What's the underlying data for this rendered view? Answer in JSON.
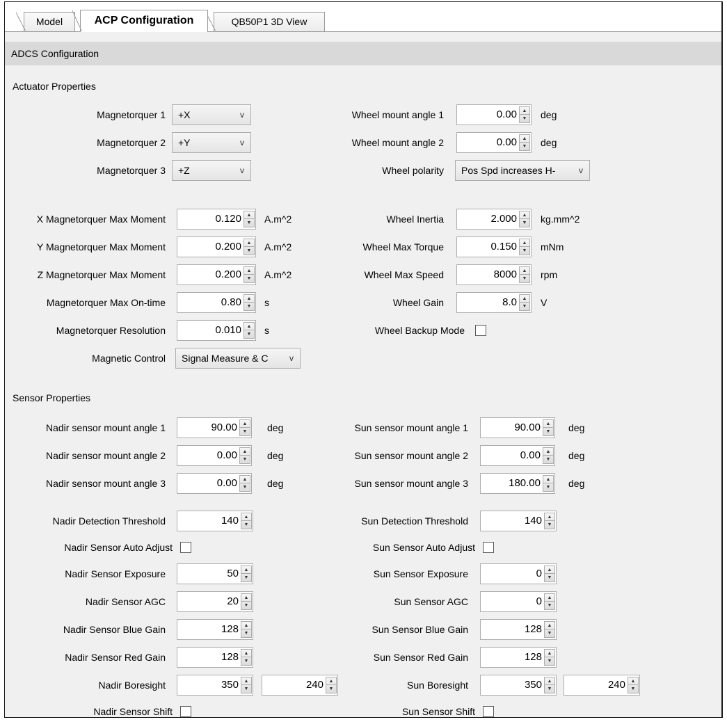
{
  "tabs": [
    "Model",
    "ACP Configuration",
    "QB50P1 3D View"
  ],
  "header": "ADCS Configuration",
  "sections": {
    "actuator": "Actuator Properties",
    "sensor": "Sensor Properties"
  },
  "units": {
    "deg": "deg",
    "am2": "A.m^2",
    "s": "s",
    "kgmm2": "kg.mm^2",
    "mNm": "mNm",
    "rpm": "rpm",
    "V": "V"
  },
  "actuator": {
    "mt1": {
      "label": "Magnetorquer 1",
      "value": "+X"
    },
    "mt2": {
      "label": "Magnetorquer 2",
      "value": "+Y"
    },
    "mt3": {
      "label": "Magnetorquer 3",
      "value": "+Z"
    },
    "wma1": {
      "label": "Wheel mount angle 1",
      "value": "0.00"
    },
    "wma2": {
      "label": "Wheel mount angle 2",
      "value": "0.00"
    },
    "wpol": {
      "label": "Wheel polarity",
      "value": "Pos Spd increases H-"
    },
    "xmax": {
      "label": "X Magnetorquer Max Moment",
      "value": "0.120"
    },
    "ymax": {
      "label": "Y Magnetorquer Max Moment",
      "value": "0.200"
    },
    "zmax": {
      "label": "Z Magnetorquer Max Moment",
      "value": "0.200"
    },
    "ontime": {
      "label": "Magnetorquer Max On-time",
      "value": "0.80"
    },
    "res": {
      "label": "Magnetorquer Resolution",
      "value": "0.010"
    },
    "magctl": {
      "label": "Magnetic Control",
      "value": "Signal Measure & C"
    },
    "winertia": {
      "label": "Wheel Inertia",
      "value": "2.000"
    },
    "wtorque": {
      "label": "Wheel Max Torque",
      "value": "0.150"
    },
    "wspeed": {
      "label": "Wheel Max Speed",
      "value": "8000"
    },
    "wgain": {
      "label": "Wheel Gain",
      "value": "8.0"
    },
    "wbackup": {
      "label": "Wheel Backup Mode",
      "checked": false
    }
  },
  "sensor": {
    "nma1": {
      "label": "Nadir sensor mount angle 1",
      "value": "90.00"
    },
    "nma2": {
      "label": "Nadir sensor mount angle 2",
      "value": "0.00"
    },
    "nma3": {
      "label": "Nadir sensor mount angle 3",
      "value": "0.00"
    },
    "sma1": {
      "label": "Sun sensor mount angle 1",
      "value": "90.00"
    },
    "sma2": {
      "label": "Sun sensor mount angle 2",
      "value": "0.00"
    },
    "sma3": {
      "label": "Sun sensor mount angle 3",
      "value": "180.00"
    },
    "ndt": {
      "label": "Nadir Detection Threshold",
      "value": "140"
    },
    "naa": {
      "label": "Nadir Sensor Auto Adjust",
      "checked": false
    },
    "nexp": {
      "label": "Nadir Sensor Exposure",
      "value": "50"
    },
    "nagc": {
      "label": "Nadir Sensor AGC",
      "value": "20"
    },
    "nblue": {
      "label": "Nadir Sensor Blue Gain",
      "value": "128"
    },
    "nred": {
      "label": "Nadir Sensor Red Gain",
      "value": "128"
    },
    "nbore": {
      "label": "Nadir Boresight",
      "x": "350",
      "y": "240"
    },
    "nshift": {
      "label": "Nadir Sensor Shift",
      "checked": false
    },
    "sdt": {
      "label": "Sun Detection Threshold",
      "value": "140"
    },
    "saa": {
      "label": "Sun Sensor Auto Adjust",
      "checked": false
    },
    "sexp": {
      "label": "Sun Sensor Exposure",
      "value": "0"
    },
    "sagc": {
      "label": "Sun Sensor AGC",
      "value": "0"
    },
    "sblue": {
      "label": "Sun Sensor Blue Gain",
      "value": "128"
    },
    "sred": {
      "label": "Sun Sensor Red Gain",
      "value": "128"
    },
    "sbore": {
      "label": "Sun Boresight",
      "x": "350",
      "y": "240"
    },
    "sshift": {
      "label": "Sun Sensor Shift",
      "checked": false
    }
  }
}
